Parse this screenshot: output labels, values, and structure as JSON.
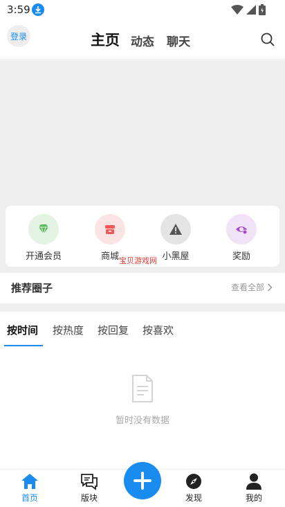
{
  "status_bar": {
    "time": "3:59"
  },
  "header": {
    "login_label": "登录",
    "tabs": [
      {
        "label": "主页",
        "active": true
      },
      {
        "label": "动态",
        "active": false
      },
      {
        "label": "聊天",
        "active": false
      }
    ]
  },
  "quick_menu": {
    "items": [
      {
        "label": "开通会员",
        "icon": "diamond-icon",
        "color": "#5cb85c",
        "bg": "#e4f4e4"
      },
      {
        "label": "商城",
        "icon": "shop-icon",
        "color": "#f05a5a",
        "bg": "#fde4e4"
      },
      {
        "label": "小黑屋",
        "icon": "warning-icon",
        "color": "#555555",
        "bg": "#e4e4e4"
      },
      {
        "label": "奖励",
        "icon": "reward-icon",
        "color": "#a44cc9",
        "bg": "#f1e2f6"
      }
    ],
    "watermark": "宝贝游戏网"
  },
  "recommended": {
    "title": "推荐圈子",
    "view_all": "查看全部"
  },
  "sort_tabs": [
    {
      "label": "按时间",
      "active": true
    },
    {
      "label": "按热度",
      "active": false
    },
    {
      "label": "按回复",
      "active": false
    },
    {
      "label": "按喜欢",
      "active": false
    }
  ],
  "empty_state": {
    "text": "暂时没有数据"
  },
  "bottom_nav": [
    {
      "label": "首页",
      "icon": "home-icon",
      "active": true
    },
    {
      "label": "版块",
      "icon": "forum-icon",
      "active": false
    },
    {
      "label": "发现",
      "icon": "compass-icon",
      "active": false
    },
    {
      "label": "我的",
      "icon": "user-icon",
      "active": false
    }
  ],
  "colors": {
    "accent": "#1a8cf0",
    "background": "#eeeeee"
  }
}
